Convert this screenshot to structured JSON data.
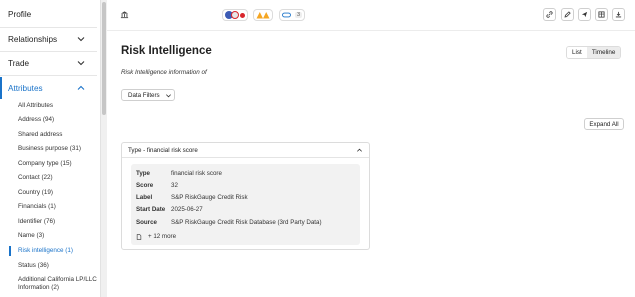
{
  "sidebar": {
    "sections": [
      {
        "label": "Profile"
      },
      {
        "label": "Relationships"
      },
      {
        "label": "Trade"
      },
      {
        "label": "Attributes"
      }
    ],
    "attributes": [
      "All Attributes",
      "Address (94)",
      "Shared address",
      "Business purpose (31)",
      "Company type (15)",
      "Contact (22)",
      "Country (19)",
      "Financials (1)",
      "Identifier (76)",
      "Name (3)",
      "Risk intelligence (1)",
      "Status (36)",
      "Additional California LP/LLC",
      "Information (2)"
    ]
  },
  "topbar": {
    "pill_count": "3"
  },
  "main": {
    "title": "Risk Intelligence",
    "subtitle": "Risk Intelligence information of",
    "toggle": {
      "list": "List",
      "timeline": "Timeline"
    },
    "filters_label": "Data Filters",
    "expand_label": "Expand All",
    "card": {
      "header": "Type - financial risk score",
      "rows": [
        {
          "key": "Type",
          "value": "financial risk score"
        },
        {
          "key": "Score",
          "value": "32"
        },
        {
          "key": "Label",
          "value": "S&P RiskGauge Credit Risk"
        },
        {
          "key": "Start Date",
          "value": "2025-06-27"
        },
        {
          "key": "Source",
          "value": "S&P RiskGauge Credit Risk Database (3rd Party Data)"
        }
      ],
      "more": "+ 12 more"
    }
  },
  "colors": {
    "accent": "#1a73c9",
    "warning": "#f5a623",
    "flag_red": "#d9262c",
    "flag_blue": "#3c5bb5"
  }
}
